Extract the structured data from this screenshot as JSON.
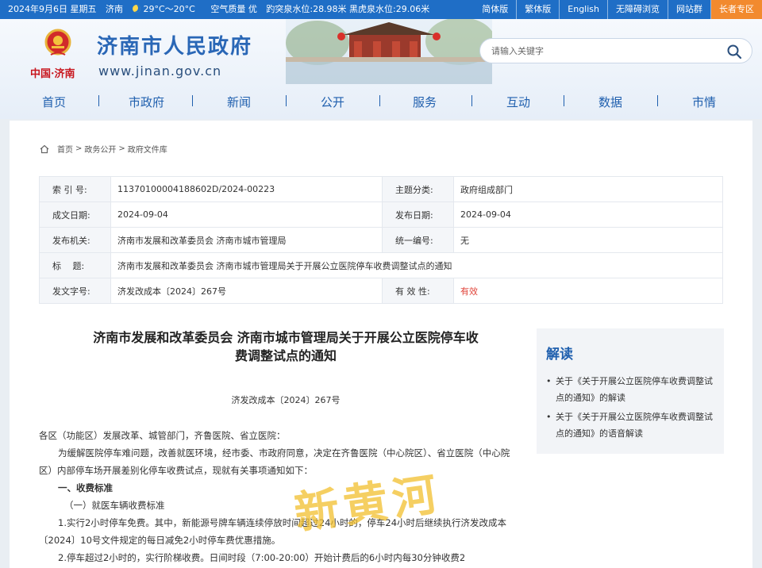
{
  "topbar": {
    "date": "2024年9月6日 星期五",
    "city": "济南",
    "temp": "29°C～20°C",
    "air": "空气质量 优",
    "water": "趵突泉水位:28.98米 黑虎泉水位:29.06米",
    "links": [
      "简体版",
      "繁体版",
      "English",
      "无障碍浏览",
      "网站群"
    ],
    "elder": "长者专区"
  },
  "header": {
    "logo_text": "中国·济南",
    "title": "济南市人民政府",
    "url": "www.jinan.gov.cn",
    "search_placeholder": "请输入关键字"
  },
  "nav": [
    "首页",
    "市政府",
    "新闻",
    "公开",
    "服务",
    "互动",
    "数据",
    "市情"
  ],
  "breadcrumb": [
    "首页",
    "政务公开",
    "政府文件库"
  ],
  "info": {
    "index_label": "索 引 号:",
    "index_value": "11370100004188602D/2024-00223",
    "topic_label": "主题分类:",
    "topic_value": "政府组成部门",
    "created_label": "成文日期:",
    "created_value": "2024-09-04",
    "published_label": "发布日期:",
    "published_value": "2024-09-04",
    "org_label": "发布机关:",
    "org_value": "济南市发展和改革委员会 济南市城市管理局",
    "unified_label": "统一编号:",
    "unified_value": "无",
    "title_label": "标　 题:",
    "title_value": "济南市发展和改革委员会 济南市城市管理局关于开展公立医院停车收费调整试点的通知",
    "docno_label": "发文字号:",
    "docno_value": "济发改成本〔2024〕267号",
    "validity_label": "有 效 性:",
    "validity_value": "有效"
  },
  "article": {
    "title_line1": "济南市发展和改革委员会 济南市城市管理局关于开展公立医院停车收",
    "title_line2": "费调整试点的通知",
    "docno": "济发改成本〔2024〕267号",
    "p1": "各区（功能区）发展改革、城管部门，齐鲁医院、省立医院：",
    "p2": "为缓解医院停车难问题，改善就医环境，经市委、市政府同意，决定在齐鲁医院（中心院区）、省立医院（中心院区）内部停车场开展差别化停车收费试点，现就有关事项通知如下：",
    "h1": "一、收费标准",
    "h2": "（一）就医车辆收费标准",
    "p3": "1.实行2小时停车免费。其中，新能源号牌车辆连续停放时间超过24小时的，停车24小时后继续执行济发改成本〔2024〕10号文件规定的每日减免2小时停车费优惠措施。",
    "p4": "2.停车超过2小时的，实行阶梯收费。日间时段（7:00-20:00）开始计费后的6小时内每30分钟收费2"
  },
  "side": {
    "title": "解读",
    "items": [
      "关于《关于开展公立医院停车收费调整试点的通知》的解读",
      "关于《关于开展公立医院停车收费调整试点的通知》的语音解读"
    ]
  },
  "watermark": "新黄河",
  "colors": {
    "topbar": "#1f6ec6",
    "elder": "#f28a2e",
    "brand_blue": "#2a67b6",
    "valid_red": "#e0443a"
  }
}
